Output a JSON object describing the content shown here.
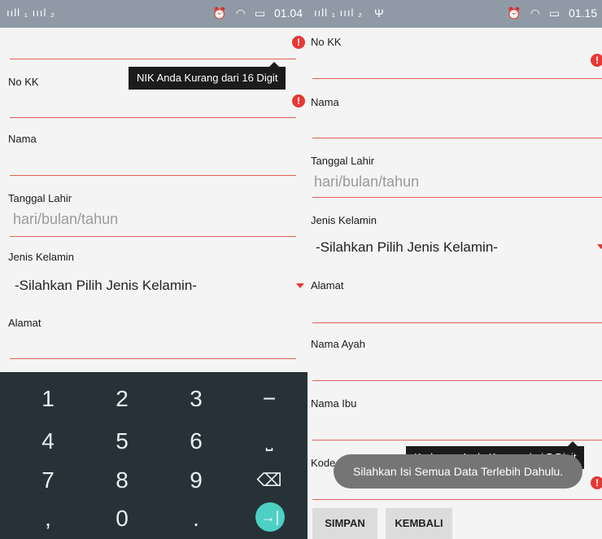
{
  "left": {
    "status": {
      "signal": "ııll ₁ ıııl ₂",
      "alarm": "⏰",
      "wifi": "◠",
      "battery": "▭",
      "time": "01.04"
    },
    "tooltip": "NIK Anda Kurang dari 16 Digit",
    "fields": {
      "no_kk": "No KK",
      "nama": "Nama",
      "tanggal_lahir": "Tanggal Lahir",
      "tanggal_hint": "hari/bulan/tahun",
      "jenis_kelamin": "Jenis Kelamin",
      "jenis_value": "-Silahkan Pilih Jenis Kelamin-",
      "alamat": "Alamat"
    },
    "keyboard": {
      "k1": "1",
      "k2": "2",
      "k3": "3",
      "kminus": "−",
      "k4": "4",
      "k5": "5",
      "k6": "6",
      "kspace": "⎵",
      "k7": "7",
      "k8": "8",
      "k9": "9",
      "kdel": "⌫",
      "kcomma": ",",
      "k0": "0",
      "kdot": ".",
      "kgo": "→|"
    }
  },
  "right": {
    "status": {
      "signal": "ııll ₁ ıııl ₂",
      "usb": "Ψ",
      "alarm": "⏰",
      "wifi": "◠",
      "battery": "▭",
      "time": "01.15"
    },
    "fields": {
      "no_kk": "No KK",
      "nama": "Nama",
      "tanggal_lahir": "Tanggal Lahir",
      "tanggal_hint": "hari/bulan/tahun",
      "jenis_kelamin": "Jenis Kelamin",
      "jenis_value": "-Silahkan Pilih Jenis Kelamin-",
      "alamat": "Alamat",
      "nama_ayah": "Nama Ayah",
      "nama_ibu": "Nama Ibu",
      "kode_pos": "Kode Pos"
    },
    "tooltip": "Kode pos Anda Kurang dari 5 Digit",
    "toast": "Silahkan Isi Semua Data Terlebih Dahulu.",
    "buttons": {
      "simpan": "SIMPAN",
      "kembali": "KEMBALI"
    }
  },
  "error_glyph": "!"
}
